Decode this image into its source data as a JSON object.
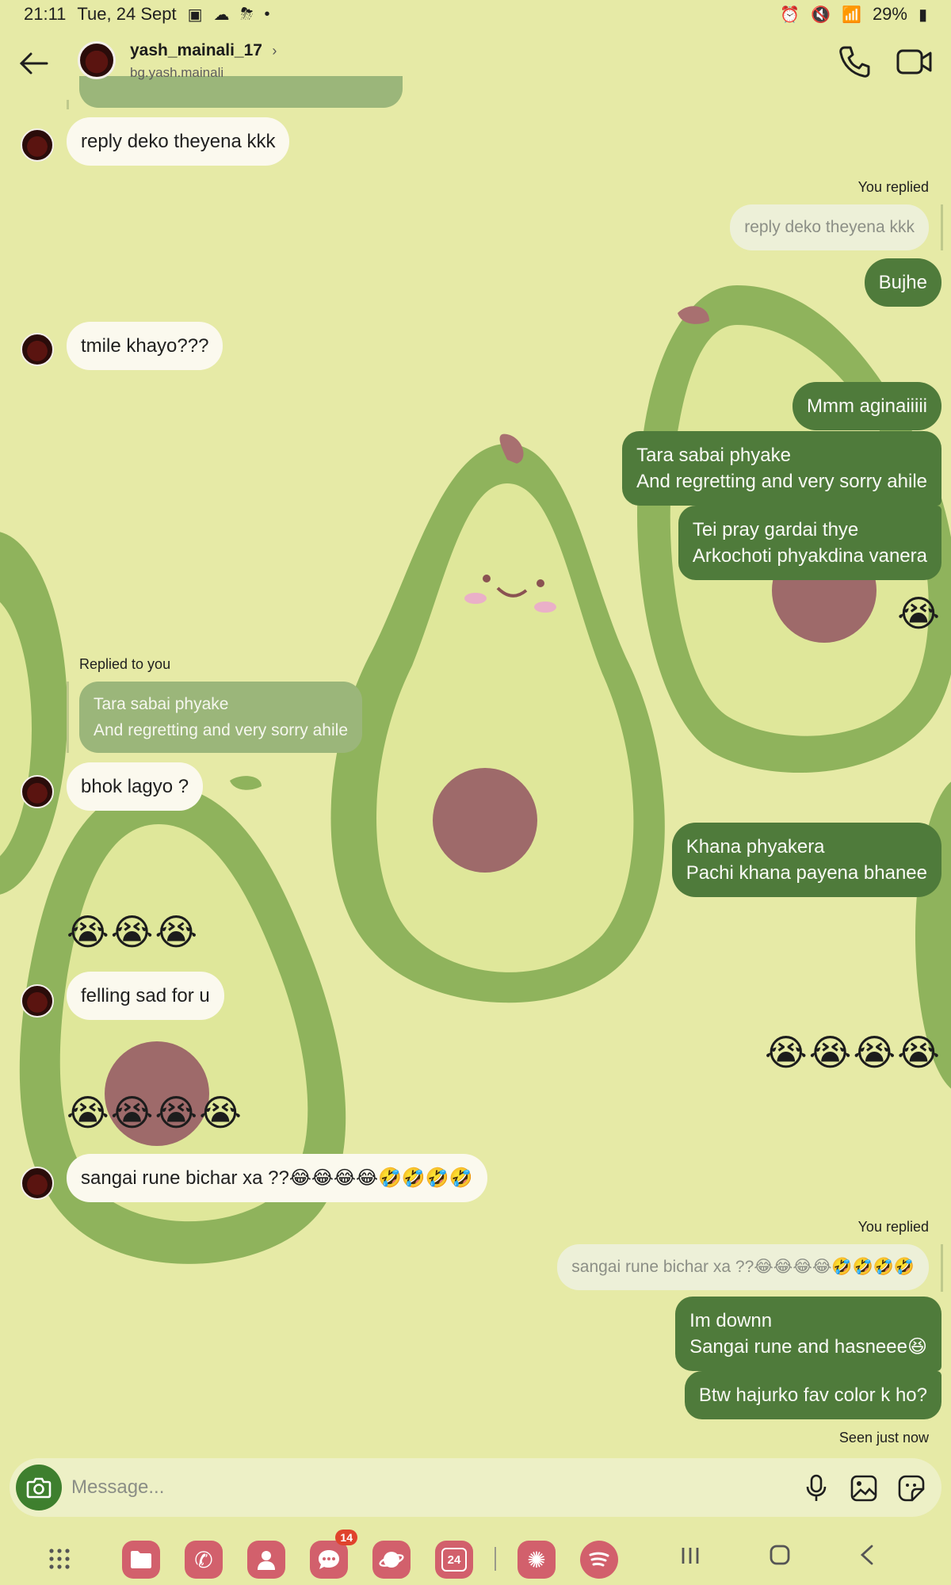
{
  "status_bar": {
    "time": "21:11",
    "date": "Tue, 24 Sept",
    "battery": "29%"
  },
  "header": {
    "name": "yash_mainali_17",
    "username": "bg.yash.mainali"
  },
  "messages": {
    "m1": "reply deko theyena kkk",
    "you_replied_1": "You replied",
    "q1": "reply deko theyena kkk",
    "m2": "Bujhe",
    "m3": "tmile khayo???",
    "m4": "Mmm aginaiiiii",
    "m5": "Tara sabai phyake\nAnd regretting and very sorry ahile",
    "m6": "Tei pray gardai thye\nArkochoti phyakdina vanera",
    "m7": "😭",
    "replied_to_you": "Replied to you",
    "q2": "Tara sabai phyake\nAnd regretting and very sorry ahile",
    "m8": "bhok lagyo ?",
    "m9": "Khana phyakera\nPachi khana payena bhanee",
    "m10": "😭😭😭",
    "m11": "felling sad for u",
    "m12": "😭😭😭😭",
    "m13": "😭😭😭😭",
    "m14": "sangai rune bichar xa ??😂😂😂😂🤣🤣🤣🤣",
    "you_replied_2": "You replied",
    "q3": "sangai rune bichar xa ??😂😂😂😂🤣🤣🤣🤣",
    "m15": "Im downn\nSangai rune and hasneee😆",
    "m16": "Btw hajurko fav color k ho?",
    "seen": "Seen just now"
  },
  "composer": {
    "placeholder": "Message..."
  },
  "nav": {
    "messages_badge": "14",
    "calendar_day": "24"
  },
  "colors": {
    "background": "#e6eaa6",
    "outgoing_bubble": "#4f7b3b",
    "incoming_bubble": "#fbf9ee",
    "camera_button": "#3e7f2e"
  }
}
